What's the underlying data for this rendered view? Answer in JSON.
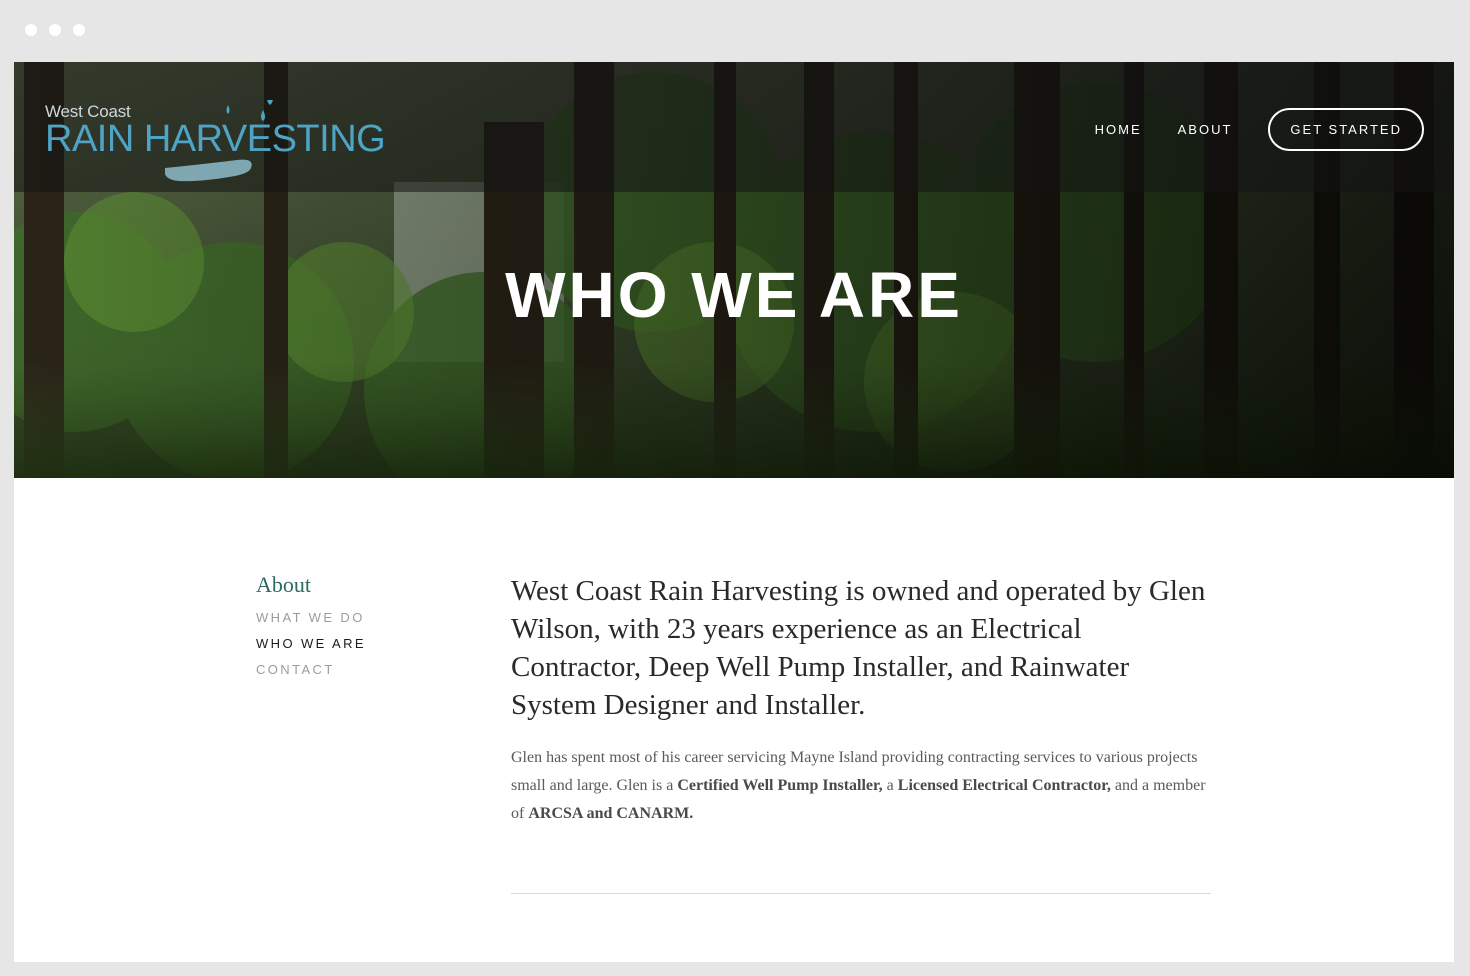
{
  "brand": {
    "small": "West Coast",
    "large": "RAIN HARVESTING"
  },
  "nav": {
    "home": "HOME",
    "about": "ABOUT",
    "cta": "GET STARTED"
  },
  "hero": {
    "title": "WHO WE ARE"
  },
  "subnav": {
    "heading": "About",
    "items": [
      "WHAT WE DO",
      "WHO WE ARE",
      "CONTACT"
    ],
    "active": "WHO WE ARE"
  },
  "content": {
    "lead": "West Coast Rain Harvesting is owned and operated by Glen Wilson, with 23 years experience as an Electrical Contractor, Deep Well Pump Installer, and Rainwater System Designer and Installer.",
    "p1": "Glen has spent most of his career servicing Mayne Island providing contracting services to various projects small and large. Glen is a ",
    "b1": "Certified Well Pump Installer,",
    "p2": " a ",
    "b2": "Licensed Electrical Contractor,",
    "p3": " and a member of ",
    "b3": "ARCSA and CANARM."
  },
  "colors": {
    "logo_blue": "#4fa3c4",
    "heading_green": "#2e6b5e",
    "frame": "#e6e6e6"
  },
  "icons": {
    "logo_mark": "hand-with-raindrops-icon"
  }
}
